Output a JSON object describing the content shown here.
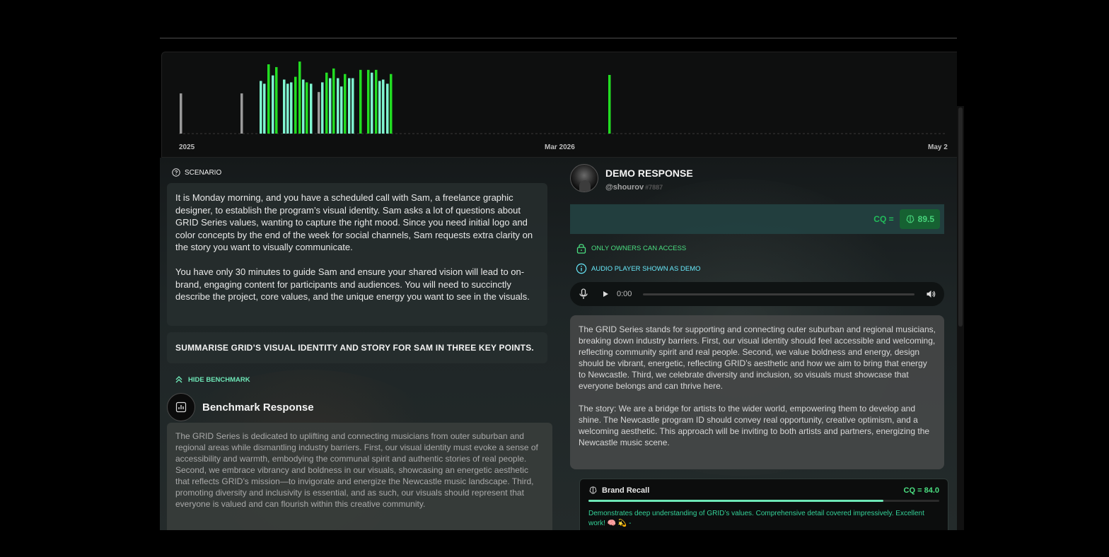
{
  "chart": {
    "tick_labels": [
      "2025",
      "Mar 2026",
      "May 2"
    ],
    "colors": {
      "bright": "#22dd22",
      "teal": "#7ff5d0",
      "gray": "#9a9a9a"
    },
    "bars": [
      {
        "color": "gray",
        "value": 0.58
      },
      {
        "color": "gray",
        "value": 0.58
      },
      {
        "color": "teal",
        "value": 0.76
      },
      {
        "color": "teal",
        "value": 0.72
      },
      {
        "color": "bright",
        "value": 1.0
      },
      {
        "color": "teal",
        "value": 0.84
      },
      {
        "color": "bright",
        "value": 0.96
      },
      {
        "color": "teal",
        "value": 0.78
      },
      {
        "color": "teal",
        "value": 0.72
      },
      {
        "color": "teal",
        "value": 0.74
      },
      {
        "color": "bright",
        "value": 0.82
      },
      {
        "color": "bright",
        "value": 1.04
      },
      {
        "color": "teal",
        "value": 0.78
      },
      {
        "color": "bright",
        "value": 0.74
      },
      {
        "color": "teal",
        "value": 0.72
      },
      {
        "color": "gray",
        "value": 0.6
      },
      {
        "color": "teal",
        "value": 0.74
      },
      {
        "color": "bright",
        "value": 0.88
      },
      {
        "color": "teal",
        "value": 0.8
      },
      {
        "color": "bright",
        "value": 0.94
      },
      {
        "color": "teal",
        "value": 0.8
      },
      {
        "color": "teal",
        "value": 0.68
      },
      {
        "color": "bright",
        "value": 0.86
      },
      {
        "color": "teal",
        "value": 0.8
      },
      {
        "color": "teal",
        "value": 0.8
      },
      {
        "color": "bright",
        "value": 0.92
      },
      {
        "color": "bright",
        "value": 0.92
      },
      {
        "color": "teal",
        "value": 0.88
      },
      {
        "color": "bright",
        "value": 0.92
      },
      {
        "color": "teal",
        "value": 0.76
      },
      {
        "color": "teal",
        "value": 0.78
      },
      {
        "color": "teal",
        "value": 0.72
      },
      {
        "color": "bright",
        "value": 0.86
      }
    ]
  },
  "scenario": {
    "label": "SCENARIO",
    "paragraphs": [
      "It is Monday morning, and you have a scheduled call with Sam, a freelance graphic designer, to establish the program’s visual identity. Sam asks a lot of questions about GRID Series values, wanting to capture the right mood. Since you need initial logo and color concepts by the end of the week for social channels, Sam requests extra clarity on the story you want to visually communicate.",
      "You have only 30 minutes to guide Sam and ensure your shared vision will lead to on-brand, engaging content for participants and audiences. You will need to succinctly describe the project, core values, and the unique energy you want to see in the visuals."
    ],
    "question": "SUMMARISE GRID’S VISUAL IDENTITY AND STORY FOR SAM IN THREE KEY POINTS."
  },
  "benchmark": {
    "toggle_label": "HIDE BENCHMARK",
    "title": "Benchmark Response",
    "text": "The GRID Series is dedicated to uplifting and connecting musicians from outer suburban and regional areas while dismantling industry barriers. First, our visual identity must evoke a sense of accessibility and warmth, embodying the communal spirit and authentic stories of real people. Second, we embrace vibrancy and boldness in our visuals, showcasing an energetic aesthetic that reflects GRID’s mission—to invigorate and energize the Newcastle music landscape. Third, promoting diversity and inclusivity is essential, and as such, our visuals should represent that everyone is valued and can flourish within this creative community."
  },
  "demo": {
    "title": "DEMO RESPONSE",
    "username": "@shourov",
    "user_tag": "#7887",
    "cq_label": "CQ =",
    "cq_value": "89.5",
    "owners_note": "ONLY OWNERS CAN ACCESS",
    "audio_note": "AUDIO PLAYER SHOWN AS DEMO",
    "audio_time": "0:00",
    "paragraphs": [
      "The GRID Series stands for supporting and connecting outer suburban and regional musicians, breaking down industry barriers. First, our visual identity should feel accessible and welcoming, reflecting community spirit and real people. Second, we value boldness and energy, design should be vibrant, energetic, reflecting GRID’s aesthetic and how we aim to bring that energy to Newcastle. Third, we celebrate diversity and inclusion, so visuals must showcase that everyone belongs and can thrive here.",
      "The story: We are a bridge for artists to the wider world, empowering them to develop and shine. The Newcastle program ID should convey real opportunity, creative optimism, and a welcoming aesthetic. This approach will be inviting to both artists and partners, energizing the Newcastle music scene."
    ]
  },
  "recall": {
    "name": "Brand Recall",
    "score": "CQ = 84.0",
    "score_fraction": 0.84,
    "feedback": "Demonstrates deep understanding of GRID’s values. Comprehensive detail covered impressively. Excellent work! 🧠 💫 -"
  }
}
